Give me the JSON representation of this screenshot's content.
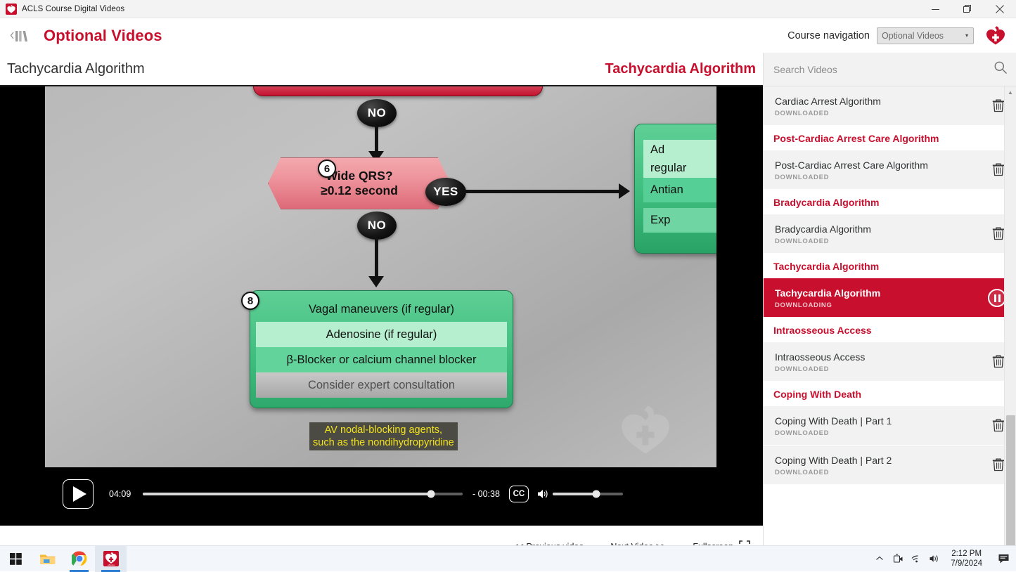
{
  "window": {
    "title": "ACLS Course Digital Videos",
    "app_icon": "aha-heart-icon",
    "minimize": "—",
    "restore": "❐",
    "close": "✕"
  },
  "header": {
    "library_icon": "library-back-icon",
    "page_title": "Optional Videos",
    "nav_label": "Course navigation",
    "nav_selected": "Optional Videos",
    "nav_caret": "⌄",
    "brand_icon": "aha-heart-logo"
  },
  "content_header": {
    "left_title": "Tachycardia Algorithm",
    "right_title": "Tachycardia Algorithm"
  },
  "player": {
    "play_label": "play-button",
    "current_time": "04:09",
    "remaining_time": "- 00:38",
    "cc_label": "CC",
    "progress_percent": 90,
    "volume_percent": 62,
    "links": {
      "previous": "<< Previous video",
      "previous_text": "Previous video",
      "next": "Next Video >>",
      "next_text": "Next Video",
      "fullscreen": "Fullscreen"
    }
  },
  "video_frame": {
    "caption_line1": "AV nodal-blocking agents,",
    "caption_line2": "such as the nondihydropyridine",
    "decision": {
      "number": "6",
      "line1": "Wide QRS?",
      "line2": "≥0.12 second",
      "branch_no_top": "NO",
      "branch_yes": "YES",
      "branch_no_bottom": "NO"
    },
    "box8": {
      "number": "8",
      "rows": [
        "Vagal maneuvers (if regular)",
        "Adenosine (if regular)",
        "β-Blocker or calcium channel blocker",
        "Consider expert consultation"
      ]
    },
    "box7": {
      "row1_line1": "Ad",
      "row1_line2": "regular",
      "row2": "Antian",
      "row3": "Exp"
    }
  },
  "search": {
    "placeholder": "Search Videos",
    "value": "",
    "icon": "search-icon"
  },
  "video_list": [
    {
      "kind": "item",
      "title": "Cardiac Arrest Algorithm",
      "status": "DOWNLOADED",
      "action": "trash-icon"
    },
    {
      "kind": "group",
      "title": "Post-Cardiac Arrest Care Algorithm"
    },
    {
      "kind": "item",
      "title": "Post-Cardiac Arrest Care Algorithm",
      "status": "DOWNLOADED",
      "action": "trash-icon"
    },
    {
      "kind": "group",
      "title": "Bradycardia Algorithm"
    },
    {
      "kind": "item",
      "title": "Bradycardia Algorithm",
      "status": "DOWNLOADED",
      "action": "trash-icon"
    },
    {
      "kind": "group",
      "title": "Tachycardia Algorithm"
    },
    {
      "kind": "item",
      "title": "Tachycardia Algorithm",
      "status": "DOWNLOADING",
      "action": "pause-icon",
      "active": true
    },
    {
      "kind": "group",
      "title": "Intraosseous Access"
    },
    {
      "kind": "item",
      "title": "Intraosseous Access",
      "status": "DOWNLOADED",
      "action": "trash-icon"
    },
    {
      "kind": "group",
      "title": "Coping With Death"
    },
    {
      "kind": "item",
      "title": "Coping With Death | Part 1",
      "status": "DOWNLOADED",
      "action": "trash-icon"
    },
    {
      "kind": "item",
      "title": "Coping With Death | Part 2",
      "status": "DOWNLOADED",
      "action": "trash-icon"
    }
  ],
  "taskbar": {
    "start": "start-button",
    "items": [
      "file-explorer-icon",
      "chrome-icon",
      "aha-app-icon"
    ],
    "tray": [
      "chevron-up-icon",
      "device-icon",
      "wifi-icon",
      "volume-icon"
    ],
    "time": "2:12 PM",
    "date": "7/9/2024",
    "notifications": "notifications-icon"
  },
  "colors": {
    "brand_red": "#c8102e",
    "accent_green": "#3dbd7d",
    "caption_yellow": "#f2e21d",
    "taskbar_bg": "#f3f6fb"
  }
}
